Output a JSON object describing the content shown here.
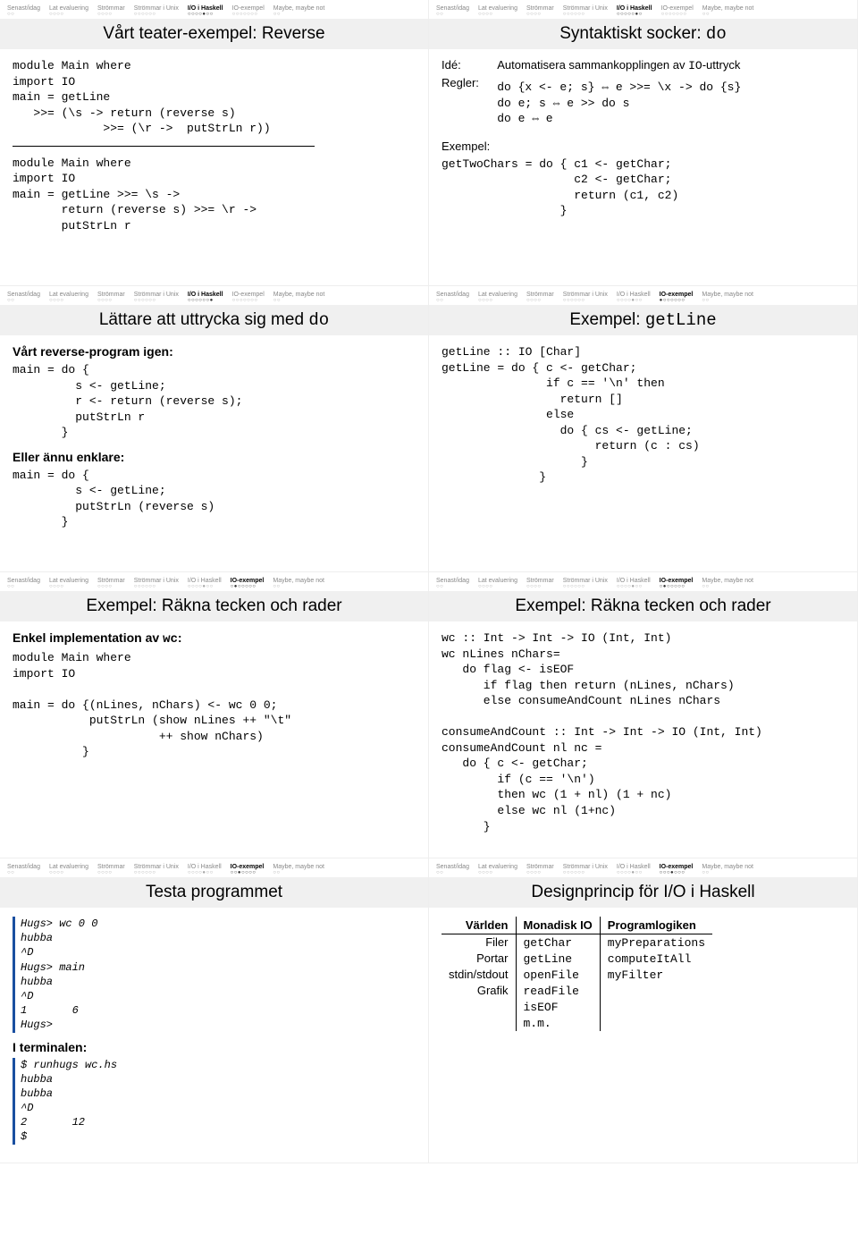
{
  "navTabs": [
    {
      "label": "Senast/idag",
      "dots": "○○"
    },
    {
      "label": "Lat evaluering",
      "dots": "○○○○"
    },
    {
      "label": "Strömmar",
      "dots": "○○○○"
    },
    {
      "label": "Strömmar i Unix",
      "dots": "○○○○○○"
    },
    {
      "label": "I/O i Haskell",
      "dots": "○○○○●○○"
    },
    {
      "label": "IO-exempel",
      "dots": "○○○○○○○"
    },
    {
      "label": "Maybe, maybe not",
      "dots": "○○"
    }
  ],
  "slides": [
    {
      "activeTab": 4,
      "activeDots": "○○○○●○○",
      "title": "Vårt teater-exempel: Reverse",
      "code1": "module Main where\nimport IO\nmain = getLine\n   >>= (\\s -> return (reverse s)\n             >>= (\\r ->  putStrLn r))",
      "code2": "module Main where\nimport IO\nmain = getLine >>= \\s ->\n       return (reverse s) >>= \\r ->\n       putStrLn r"
    },
    {
      "activeTab": 4,
      "activeDots": "○○○○○●○",
      "title": "Syntaktiskt socker: ",
      "titleCode": "do",
      "idea_label": "Idé:",
      "idea": "Automatisera sammankopplingen av ",
      "ideaCode": "IO",
      "ideaTail": "-uttryck",
      "rules_label": "Regler:",
      "rules": "do {x <- e; s} ⇔ e >>= \\x -> do {s}\ndo e; s ⇔ e >> do s\ndo e ⇔ e",
      "example_label": "Exempel:",
      "example": "getTwoChars = do { c1 <- getChar;\n                   c2 <- getChar;\n                   return (c1, c2)\n                 }"
    },
    {
      "activeTab": 4,
      "activeDots": "○○○○○○●",
      "title": "Lättare att uttrycka sig med ",
      "titleCode": "do",
      "sub1": "Vårt reverse-program igen:",
      "code1": "main = do {\n         s <- getLine;\n         r <- return (reverse s);\n         putStrLn r\n       }",
      "sub2": "Eller ännu enklare:",
      "code2": "main = do {\n         s <- getLine;\n         putStrLn (reverse s)\n       }"
    },
    {
      "activeTab": 5,
      "activeDots": "●○○○○○○",
      "title": "Exempel: ",
      "titleCode": "getLine",
      "code1": "getLine :: IO [Char]\ngetLine = do { c <- getChar;\n               if c == '\\n' then\n                 return []\n               else\n                 do { cs <- getLine;\n                      return (c : cs)\n                    }\n              }"
    },
    {
      "activeTab": 5,
      "activeDots": "○●○○○○○",
      "title": "Exempel: Räkna tecken och rader",
      "sub1": "Enkel implementation av ",
      "sub1Code": "wc",
      "sub1Tail": ":",
      "code1": "module Main where\nimport IO\n\nmain = do {(nLines, nChars) <- wc 0 0;\n           putStrLn (show nLines ++ \"\\t\"\n                     ++ show nChars)\n          }"
    },
    {
      "activeTab": 5,
      "activeDots": "○●○○○○○",
      "title": "Exempel: Räkna tecken och rader",
      "code1": "wc :: Int -> Int -> IO (Int, Int)\nwc nLines nChars=\n   do flag <- isEOF\n      if flag then return (nLines, nChars)\n      else consumeAndCount nLines nChars\n\nconsumeAndCount :: Int -> Int -> IO (Int, Int)\nconsumeAndCount nl nc =\n   do { c <- getChar;\n        if (c == '\\n')\n        then wc (1 + nl) (1 + nc)\n        else wc nl (1+nc)\n      }"
    },
    {
      "activeTab": 5,
      "activeDots": "○○●○○○○",
      "title": "Testa programmet",
      "term1": "Hugs> wc 0 0\nhubba\n^D\nHugs> main\nhubba\n^D\n1       6\nHugs>",
      "sub2": "I terminalen:",
      "term2": "$ runhugs wc.hs\nhubba\nbubba\n^D\n2       12\n$"
    },
    {
      "activeTab": 5,
      "activeDots": "○○○●○○○",
      "title": "Designprincip för I/O i Haskell",
      "table": {
        "headers": [
          "Världen",
          "Monadisk IO",
          "Programlogiken"
        ],
        "col1": [
          "Filer",
          "Portar",
          "stdin/stdout",
          "Grafik"
        ],
        "col2": [
          "getChar",
          "getLine",
          "openFile",
          "readFile",
          "isEOF",
          "m.m."
        ],
        "col3": [
          "myPreparations",
          "computeItAll",
          "myFilter"
        ]
      }
    }
  ]
}
